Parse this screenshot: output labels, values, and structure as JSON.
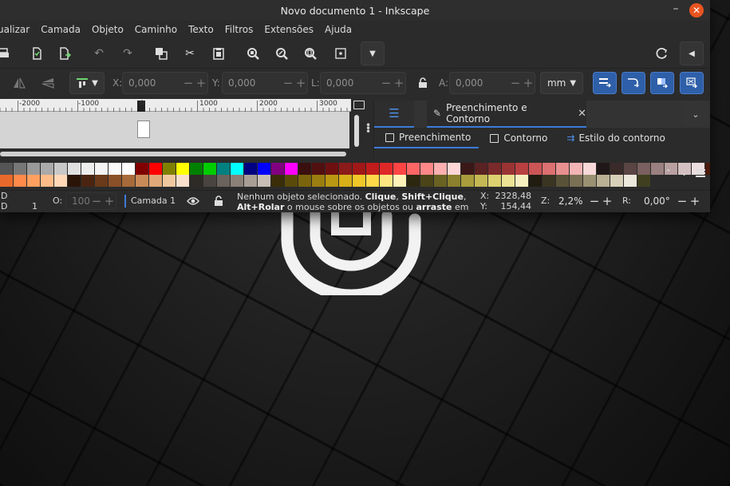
{
  "window": {
    "title": "Novo documento 1 - Inkscape"
  },
  "menu": [
    "ualizar",
    "Camada",
    "Objeto",
    "Caminho",
    "Texto",
    "Filtros",
    "Extensões",
    "Ajuda"
  ],
  "controls": {
    "x_label": "X:",
    "x_value": "0,000",
    "y_label": "Y:",
    "y_value": "0,000",
    "l_label": "L:",
    "l_value": "0,000",
    "a_label": "A:",
    "a_value": "0,000",
    "unit": "mm"
  },
  "ruler": {
    "labels": [
      "-2000",
      "-1000",
      "0",
      "1000",
      "2000",
      "3000"
    ]
  },
  "dock": {
    "tab_title": "Preenchimento e Contorno",
    "subtabs": [
      "Preenchimento",
      "Contorno",
      "Estilo do contorno"
    ]
  },
  "palette": {
    "row1": [
      "#555555",
      "#777777",
      "#999999",
      "#aaaaaa",
      "#c8c8c8",
      "#e0e0e0",
      "#eeeeee",
      "#f4f4f4",
      "#fafafa",
      "#ffffff",
      "#800000",
      "#ff0000",
      "#808000",
      "#ffff00",
      "#008000",
      "#00cc00",
      "#008080",
      "#00ffff",
      "#000080",
      "#0000ff",
      "#800080",
      "#ff00ff",
      "#3a0f0f",
      "#501010",
      "#6e1010",
      "#8b1a1a",
      "#a01818",
      "#c01c1c",
      "#e02828",
      "#ff4444",
      "#ff6666",
      "#ff8888",
      "#ffb0b0",
      "#ffd6d6",
      "#3a1818",
      "#5a2222",
      "#7a2a2a",
      "#9a3434",
      "#b84040",
      "#cc5555",
      "#dd7070",
      "#e99090",
      "#f2b4b4",
      "#f8d8d8",
      "#201818",
      "#3a2a2a",
      "#5a4444",
      "#7a6060",
      "#9a8080",
      "#b8a0a0",
      "#d4c0c0",
      "#ecdede",
      "#4a1a0a"
    ],
    "row2": [
      "#e86a2a",
      "#ff8a4a",
      "#ffa060",
      "#ffbc88",
      "#ffd8b8",
      "#2a1408",
      "#4a2410",
      "#6a3a1a",
      "#8a5028",
      "#a86a3a",
      "#c88a58",
      "#e0a878",
      "#f0c8a0",
      "#f8e0cc",
      "#2e2a26",
      "#4a4440",
      "#6a625c",
      "#8a8078",
      "#a89e96",
      "#c8beb6",
      "#3a2e08",
      "#5a4a0a",
      "#7a640c",
      "#9a7e10",
      "#ba9812",
      "#d8b018",
      "#f0c828",
      "#ffd84a",
      "#ffe680",
      "#fff2b8",
      "#2c2810",
      "#4a4418",
      "#6a6222",
      "#8a802e",
      "#a89c3c",
      "#c4b854",
      "#dcd070",
      "#ece494",
      "#f6f0c0",
      "#201c10",
      "#3a3422",
      "#5a5238",
      "#7a7054",
      "#9a9072",
      "#bab094",
      "#d8d0b8",
      "#ece8dc",
      "#404020"
    ]
  },
  "status": {
    "d1": "D",
    "d2": "D",
    "one": "1",
    "opacity_label": "O:",
    "opacity_value": "100",
    "layer": "Camada 1",
    "msg_plain1": "Nenhum objeto selecionado. ",
    "msg_bold1": "Clique",
    "msg_sep1": ", ",
    "msg_bold2": "Shift+Clique",
    "msg_sep2": ",",
    "msg_bold3": "Alt+Rolar",
    "msg_plain2": " o mouse sobre os objetos ou ",
    "msg_bold4": "arraste",
    "msg_plain3": " em vo...",
    "x_label": "X:",
    "x_value": "2328,48",
    "y_label": "Y:",
    "y_value": "154,44",
    "z_label": "Z:",
    "zoom": "2,2%",
    "r_label": "R:",
    "rotation": "0,00°"
  }
}
